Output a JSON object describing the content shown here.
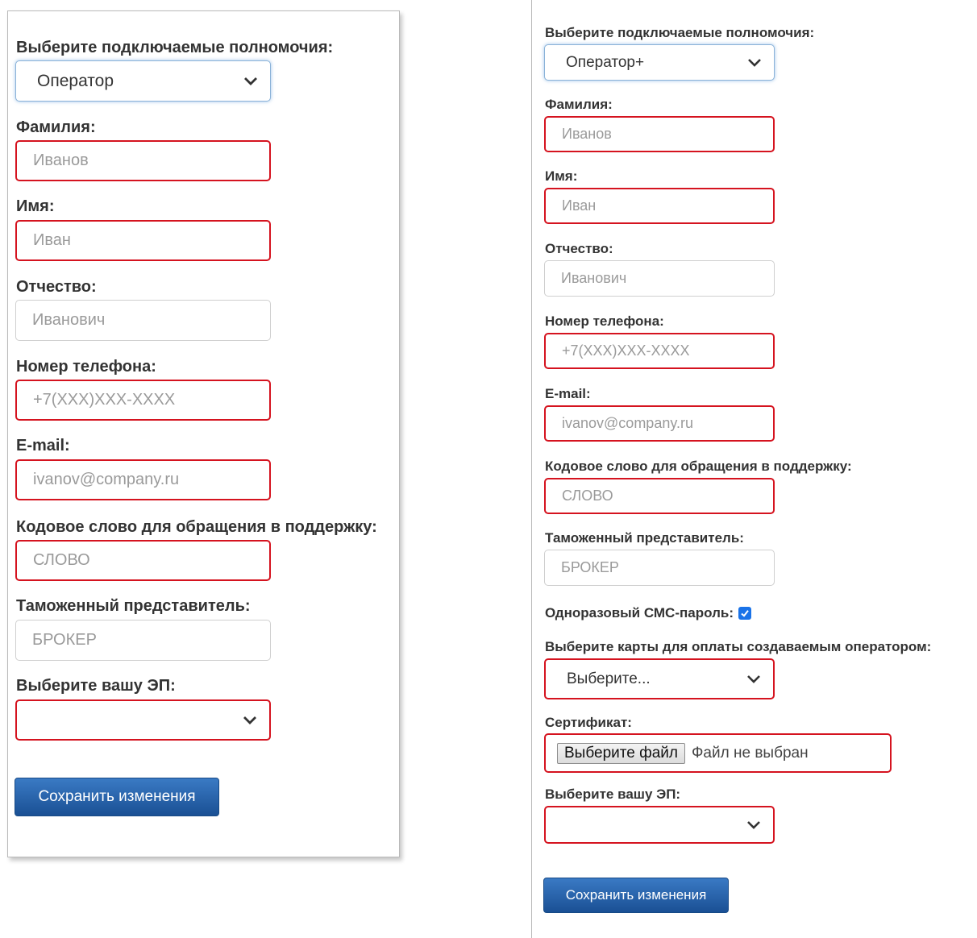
{
  "left_form": {
    "powers_label": "Выберите подключаемые полномочия:",
    "powers_value": "Оператор",
    "surname_label": "Фамилия:",
    "surname_placeholder": "Иванов",
    "name_label": "Имя:",
    "name_placeholder": "Иван",
    "patronymic_label": "Отчество:",
    "patronymic_placeholder": "Иванович",
    "phone_label": "Номер телефона:",
    "phone_placeholder": "+7(XXX)XXX-XXXX",
    "email_label": "E-mail:",
    "email_placeholder": "ivanov@company.ru",
    "codeword_label": "Кодовое слово для обращения в поддержку:",
    "codeword_placeholder": "СЛОВО",
    "customs_label": "Таможенный представитель:",
    "customs_placeholder": "БРОКЕР",
    "signature_label": "Выберите вашу ЭП:",
    "signature_value": "",
    "save_label": "Сохранить изменения"
  },
  "right_form": {
    "powers_label": "Выберите подключаемые полномочия:",
    "powers_value": "Оператор+",
    "surname_label": "Фамилия:",
    "surname_placeholder": "Иванов",
    "name_label": "Имя:",
    "name_placeholder": "Иван",
    "patronymic_label": "Отчество:",
    "patronymic_placeholder": "Иванович",
    "phone_label": "Номер телефона:",
    "phone_placeholder": "+7(XXX)XXX-XXXX",
    "email_label": "E-mail:",
    "email_placeholder": "ivanov@company.ru",
    "codeword_label": "Кодовое слово для обращения в поддержку:",
    "codeword_placeholder": "СЛОВО",
    "customs_label": "Таможенный представитель:",
    "customs_placeholder": "БРОКЕР",
    "sms_label": "Одноразовый СМС-пароль:",
    "sms_checked": true,
    "cards_label": "Выберите карты для оплаты создаваемым оператором:",
    "cards_value": "Выберите...",
    "certificate_label": "Сертификат:",
    "file_button_label": "Выберите файл",
    "file_status": "Файл не выбран",
    "signature_label": "Выберите вашу ЭП:",
    "signature_value": "",
    "save_label": "Сохранить изменения"
  },
  "colors": {
    "error_border": "#d5131f",
    "focus_border": "#8ab2d8",
    "button_blue": "#1f5a9e",
    "checkbox_blue": "#1a73e8"
  },
  "icons": [
    "chevron-down-icon",
    "checkmark-icon"
  ]
}
